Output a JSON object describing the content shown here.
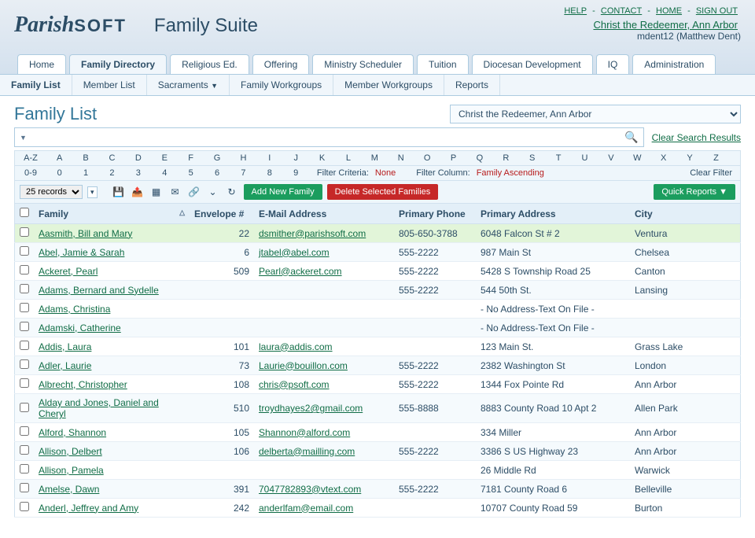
{
  "header": {
    "logo_parish": "Parish",
    "logo_soft": "SOFT",
    "suite_title": "Family Suite",
    "links": {
      "help": "HELP",
      "contact": "CONTACT",
      "home": "HOME",
      "signout": "SIGN OUT"
    },
    "org_name": "Christ the Redeemer, Ann Arbor",
    "user_line": "mdent12 (Matthew Dent)"
  },
  "main_tabs": [
    "Home",
    "Family Directory",
    "Religious Ed.",
    "Offering",
    "Ministry Scheduler",
    "Tuition",
    "Diocesan Development",
    "IQ",
    "Administration"
  ],
  "main_tab_active": 1,
  "sub_tabs": [
    {
      "label": "Family List",
      "caret": false
    },
    {
      "label": "Member List",
      "caret": false
    },
    {
      "label": "Sacraments",
      "caret": true
    },
    {
      "label": "Family Workgroups",
      "caret": false
    },
    {
      "label": "Member Workgroups",
      "caret": false
    },
    {
      "label": "Reports",
      "caret": false
    }
  ],
  "sub_tab_active": 0,
  "page_title": "Family List",
  "org_select_value": "Christ the Redeemer, Ann Arbor",
  "clear_search_label": "Clear Search Results",
  "alpha": [
    "A-Z",
    "A",
    "B",
    "C",
    "D",
    "E",
    "F",
    "G",
    "H",
    "I",
    "J",
    "K",
    "L",
    "M",
    "N",
    "O",
    "P",
    "Q",
    "R",
    "S",
    "T",
    "U",
    "V",
    "W",
    "X",
    "Y",
    "Z"
  ],
  "nums": [
    "0-9",
    "0",
    "1",
    "2",
    "3",
    "4",
    "5",
    "6",
    "7",
    "8",
    "9"
  ],
  "filter": {
    "criteria_label": "Filter Criteria:",
    "criteria_value": "None",
    "column_label": "Filter Column:",
    "column_value": "Family Ascending",
    "clear_label": "Clear Filter"
  },
  "toolbar": {
    "records_value": "25 records",
    "add_label": "Add New Family",
    "delete_label": "Delete Selected Families",
    "quick_label": "Quick Reports ▼"
  },
  "columns": {
    "family": "Family",
    "envelope": "Envelope #",
    "email": "E-Mail Address",
    "phone": "Primary Phone",
    "address": "Primary Address",
    "city": "City"
  },
  "rows": [
    {
      "family": "Aasmith, Bill and Mary",
      "envelope": "22",
      "email": "dsmither@parishsoft.com",
      "phone": "805-650-3788",
      "address": "6048 Falcon St # 2",
      "city": "Ventura",
      "hl": true
    },
    {
      "family": "Abel, Jamie & Sarah",
      "envelope": "6",
      "email": "jtabel@abel.com",
      "phone": "555-2222",
      "address": "987 Main St",
      "city": "Chelsea"
    },
    {
      "family": "Ackeret, Pearl",
      "envelope": "509",
      "email": "Pearl@ackeret.com",
      "phone": "555-2222",
      "address": "5428 S Township Road 25",
      "city": "Canton"
    },
    {
      "family": "Adams, Bernard and Sydelle",
      "envelope": "",
      "email": "",
      "phone": "555-2222",
      "address": "544 50th St.",
      "city": "Lansing"
    },
    {
      "family": "Adams, Christina",
      "envelope": "",
      "email": "",
      "phone": "",
      "address": "- No Address-Text On File -",
      "city": ""
    },
    {
      "family": "Adamski, Catherine",
      "envelope": "",
      "email": "",
      "phone": "",
      "address": "- No Address-Text On File -",
      "city": ""
    },
    {
      "family": "Addis, Laura",
      "envelope": "101",
      "email": "laura@addis.com",
      "phone": "",
      "address": "123 Main St.",
      "city": "Grass Lake"
    },
    {
      "family": "Adler, Laurie",
      "envelope": "73",
      "email": "Laurie@bouillon.com",
      "phone": "555-2222",
      "address": "2382 Washington St",
      "city": "London"
    },
    {
      "family": "Albrecht, Christopher",
      "envelope": "108",
      "email": "chris@psoft.com",
      "phone": "555-2222",
      "address": "1344 Fox Pointe Rd",
      "city": "Ann Arbor"
    },
    {
      "family": "Alday and Jones, Daniel and Cheryl",
      "envelope": "510",
      "email": "troydhayes2@gmail.com",
      "phone": "555-8888",
      "address": "8883 County Road 10 Apt 2",
      "city": "Allen Park"
    },
    {
      "family": "Alford, Shannon",
      "envelope": "105",
      "email": "Shannon@alford.com",
      "phone": "",
      "address": "334 Miller",
      "city": "Ann Arbor"
    },
    {
      "family": "Allison, Delbert",
      "envelope": "106",
      "email": "delberta@mailling.com",
      "phone": "555-2222",
      "address": "3386 S US Highway 23",
      "city": "Ann Arbor"
    },
    {
      "family": "Allison, Pamela",
      "envelope": "",
      "email": "",
      "phone": "",
      "address": "26 Middle Rd",
      "city": "Warwick"
    },
    {
      "family": "Amelse, Dawn",
      "envelope": "391",
      "email": "7047782893@vtext.com",
      "phone": "555-2222",
      "address": "7181 County Road 6",
      "city": "Belleville"
    },
    {
      "family": "Anderl, Jeffrey and Amy",
      "envelope": "242",
      "email": "anderlfam@email.com",
      "phone": "",
      "address": "10707 County Road 59",
      "city": "Burton"
    }
  ]
}
